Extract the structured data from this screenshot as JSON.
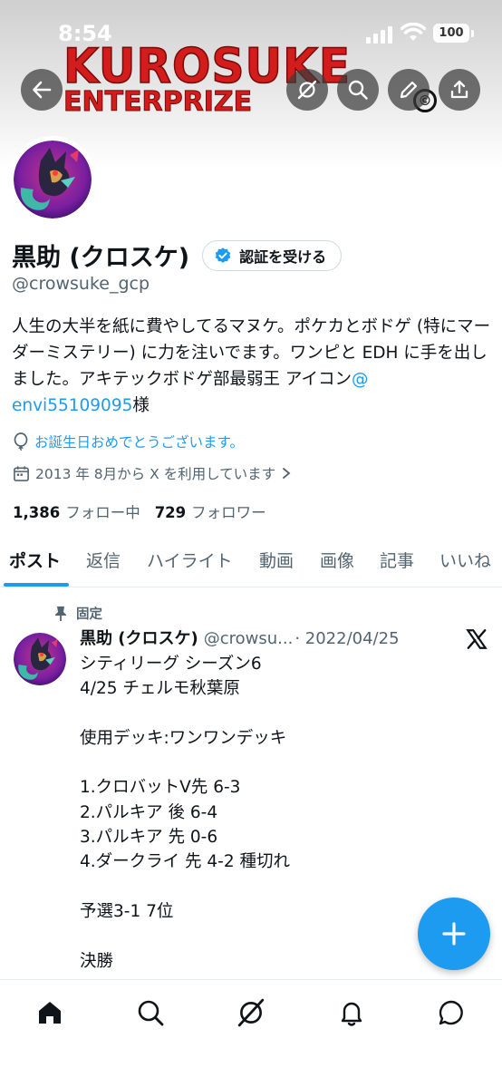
{
  "status_bar": {
    "time": "8:54",
    "battery": "100"
  },
  "banner": {
    "brand_line1": "KUROSUKE",
    "brand_line2": "ENTERPRIZE",
    "mark": "©"
  },
  "header_icons": [
    "back-arrow-icon",
    "grok-icon",
    "search-icon",
    "edit-pencil-icon",
    "share-icon"
  ],
  "profile": {
    "display_name": "黒助 (クロスケ)",
    "verify_button_label": "認証を受ける",
    "handle": "@crowsuke_gcp",
    "bio_text": "人生の大半を紙に費やしてるマヌケ。ポケカとボドゲ (特にマーダーミステリー) に力を注いでます。ワンピと EDH に手を出しました。アキテックボドゲ部最弱王 アイコン",
    "bio_mention": "@ envi55109095",
    "bio_suffix": "様",
    "birthday_text": "お誕生日おめでとうございます。",
    "joined_text": "2013 年 8月から X を利用しています",
    "following_count": "1,386",
    "following_label": "フォロー中",
    "followers_count": "729",
    "followers_label": "フォロワー"
  },
  "tabs": [
    {
      "label": "ポスト",
      "active": true
    },
    {
      "label": "返信",
      "active": false
    },
    {
      "label": "ハイライト",
      "active": false
    },
    {
      "label": "動画",
      "active": false
    },
    {
      "label": "画像",
      "active": false
    },
    {
      "label": "記事",
      "active": false
    },
    {
      "label": "いいね",
      "active": false
    }
  ],
  "post": {
    "pinned_label": "固定",
    "author_name": "黒助 (クロスケ)",
    "author_handle": "@crowsu...",
    "date": "· 2022/04/25",
    "body": "シティリーグ シーズン6\n4/25 チェルモ秋葉原\n\n使用デッキ:ワンワンデッキ\n\n1.クロバットV先 6-3\n2.パルキア 後 6-4\n3.パルキア 先 0-6\n4.ダークライ 先 4-2 種切れ\n\n予選3-1 7位\n\n決勝"
  },
  "fab_icon": "compose-plus-icon",
  "bottom_nav": [
    "home-icon",
    "search-icon",
    "grok-icon",
    "notifications-bell-icon",
    "messages-icon"
  ],
  "colors": {
    "accent": "#1d9bf0",
    "text": "#0f1419",
    "muted": "#536471",
    "brand_red": "#d31c1c"
  }
}
